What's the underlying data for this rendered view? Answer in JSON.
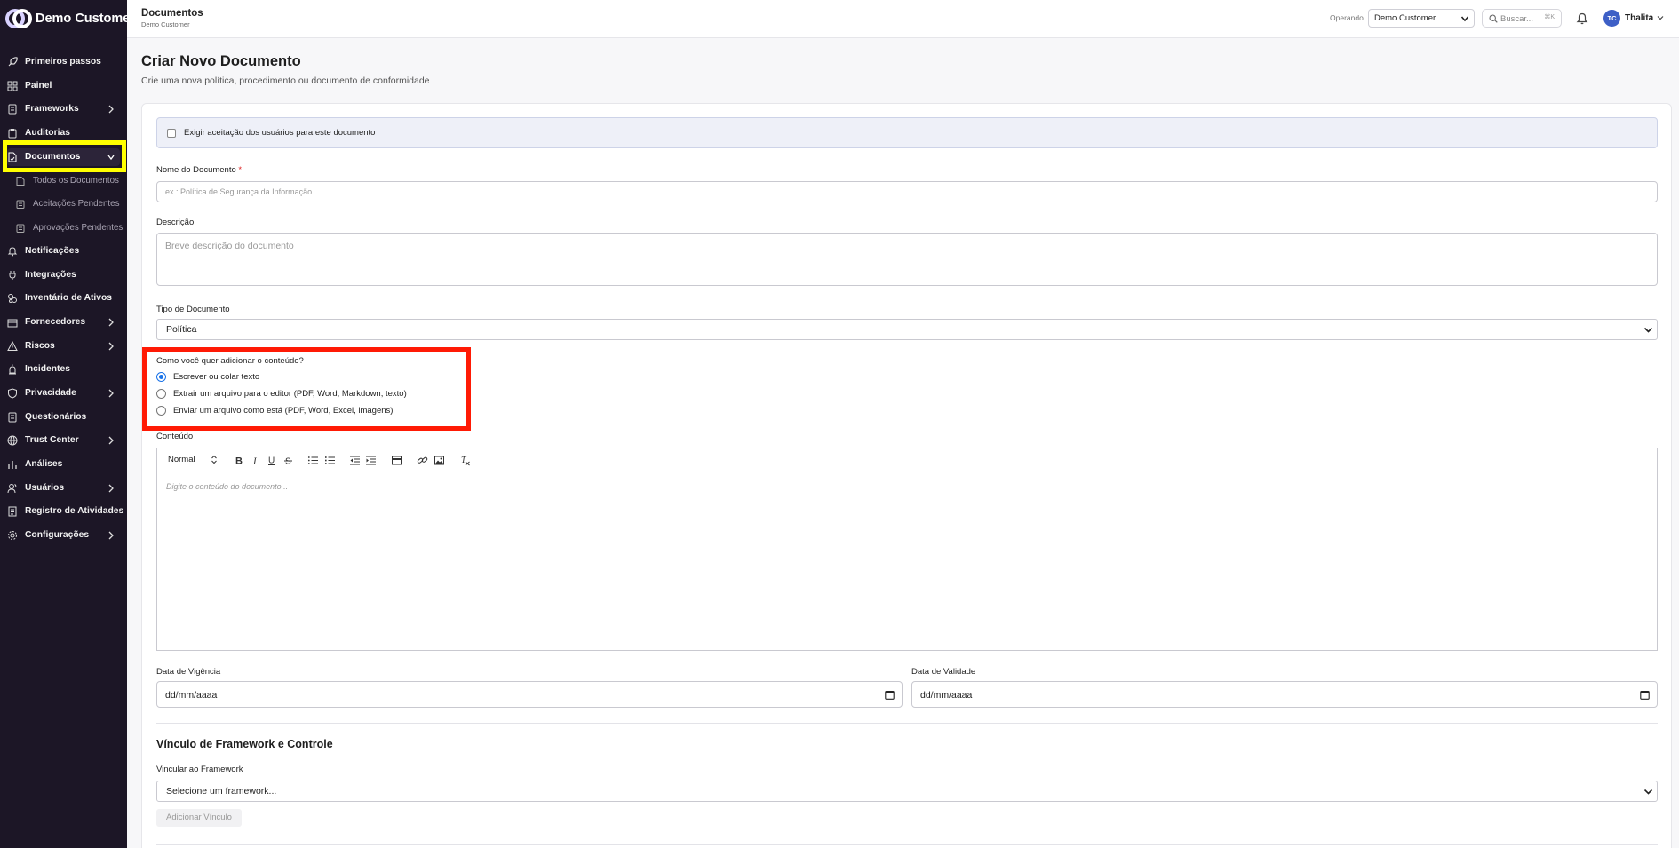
{
  "brand": {
    "name": "Demo Customer"
  },
  "sidebar": {
    "items": [
      {
        "label": "Primeiros passos",
        "icon": "rocket-icon"
      },
      {
        "label": "Painel",
        "icon": "dashboard-icon"
      },
      {
        "label": "Frameworks",
        "icon": "book-icon"
      },
      {
        "label": "Auditorias",
        "icon": "clipboard-icon"
      },
      {
        "label": "Documentos",
        "icon": "document-icon"
      },
      {
        "label": "Todos os Documentos",
        "icon": "file-icon"
      },
      {
        "label": "Aceitações Pendentes",
        "icon": "clipboard-check-icon"
      },
      {
        "label": "Aprovações Pendentes",
        "icon": "clipboard-list-icon"
      },
      {
        "label": "Notificações",
        "icon": "bell-icon"
      },
      {
        "label": "Integrações",
        "icon": "plug-icon"
      },
      {
        "label": "Inventário de Ativos",
        "icon": "assets-icon"
      },
      {
        "label": "Fornecedores",
        "icon": "building-icon"
      },
      {
        "label": "Riscos",
        "icon": "warning-icon"
      },
      {
        "label": "Incidentes",
        "icon": "siren-icon"
      },
      {
        "label": "Privacidade",
        "icon": "shield-icon"
      },
      {
        "label": "Questionários",
        "icon": "questionnaire-icon"
      },
      {
        "label": "Trust Center",
        "icon": "globe-icon"
      },
      {
        "label": "Análises",
        "icon": "bar-chart-icon"
      },
      {
        "label": "Usuários",
        "icon": "users-icon"
      },
      {
        "label": "Registro de Atividades",
        "icon": "activity-log-icon"
      },
      {
        "label": "Configurações",
        "icon": "gear-icon"
      }
    ]
  },
  "header": {
    "title": "Documentos",
    "subtitle": "Demo Customer",
    "operating_label": "Operando",
    "operating_value": "Demo Customer",
    "search_placeholder": "Buscar...",
    "search_shortcut": "⌘K",
    "user_initials": "TC",
    "user_name": "Thalita"
  },
  "main": {
    "title": "Criar Novo Documento",
    "subtitle": "Crie uma nova política, procedimento ou documento de conformidade",
    "require_acceptance_label": "Exigir aceitação dos usuários para este documento",
    "name_label": "Nome do Documento",
    "name_required": "*",
    "name_placeholder": "ex.: Política de Segurança da Informação",
    "description_label": "Descrição",
    "description_placeholder": "Breve descrição do documento",
    "type_label": "Tipo de Documento",
    "type_value": "Política",
    "content_question": "Como você quer adicionar o conteúdo?",
    "content_options": [
      {
        "label": "Escrever ou colar texto",
        "selected": true
      },
      {
        "label": "Extrair um arquivo para o editor (PDF, Word, Markdown, texto)",
        "selected": false
      },
      {
        "label": "Enviar um arquivo como está (PDF, Word, Excel, imagens)",
        "selected": false
      }
    ],
    "content_label": "Conteúdo",
    "editor_format": "Normal",
    "editor_placeholder": "Digite o conteúdo do documento...",
    "effective_date_label": "Data de Vigência",
    "effective_date_value": "dd/mm/aaaa",
    "expiry_date_label": "Data de Validade",
    "expiry_date_value": "dd/mm/aaaa",
    "framework_section_title": "Vínculo de Framework e Controle",
    "framework_label": "Vincular ao Framework",
    "framework_placeholder": "Selecione um framework...",
    "add_link_button": "Adicionar Vínculo"
  },
  "colors": {
    "sidebar_bg": "#1c1626",
    "highlight_yellow": "#ffff00",
    "highlight_red": "#ff1a05",
    "radio_selected": "#1a73e8",
    "avatar_bg": "#3d5fc6"
  }
}
